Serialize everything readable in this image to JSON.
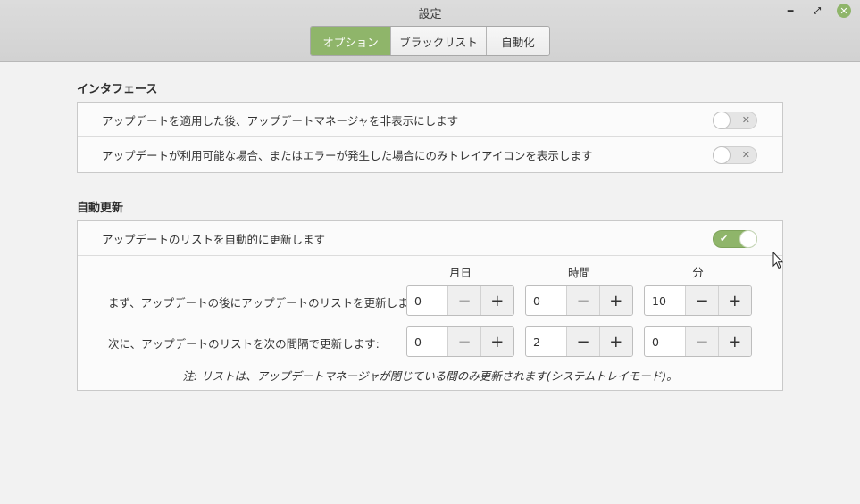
{
  "window": {
    "title": "設定",
    "tabs": [
      {
        "label": "オプション",
        "active": true
      },
      {
        "label": "ブラックリスト",
        "active": false
      },
      {
        "label": "自動化",
        "active": false
      }
    ]
  },
  "interface": {
    "title": "インタフェース",
    "items": [
      {
        "label": "アップデートを適用した後、アップデートマネージャを非表示にします",
        "enabled": false
      },
      {
        "label": "アップデートが利用可能な場合、またはエラーが発生した場合にのみトレイアイコンを表示します",
        "enabled": false
      }
    ]
  },
  "auto_refresh": {
    "title": "自動更新",
    "toggle_label": "アップデートのリストを自動的に更新します",
    "enabled": true,
    "columns": [
      "月日",
      "時間",
      "分"
    ],
    "rows": [
      {
        "label": "まず、アップデートの後にアップデートのリストを更新します:",
        "values": [
          "0",
          "0",
          "10"
        ]
      },
      {
        "label": "次に、アップデートのリストを次の間隔で更新します:",
        "values": [
          "0",
          "2",
          "0"
        ]
      }
    ],
    "note": "注: リストは、アップデートマネージャが閉じている間のみ更新されます(システムトレイモード)。"
  },
  "icons": {
    "minimize": "minimize-icon",
    "maximize": "maximize-icon",
    "close": "close-icon",
    "minus": "minus-icon",
    "plus": "plus-icon",
    "check": "check-icon",
    "cross": "cross-icon"
  },
  "colors": {
    "accent": "#8fb56a"
  }
}
